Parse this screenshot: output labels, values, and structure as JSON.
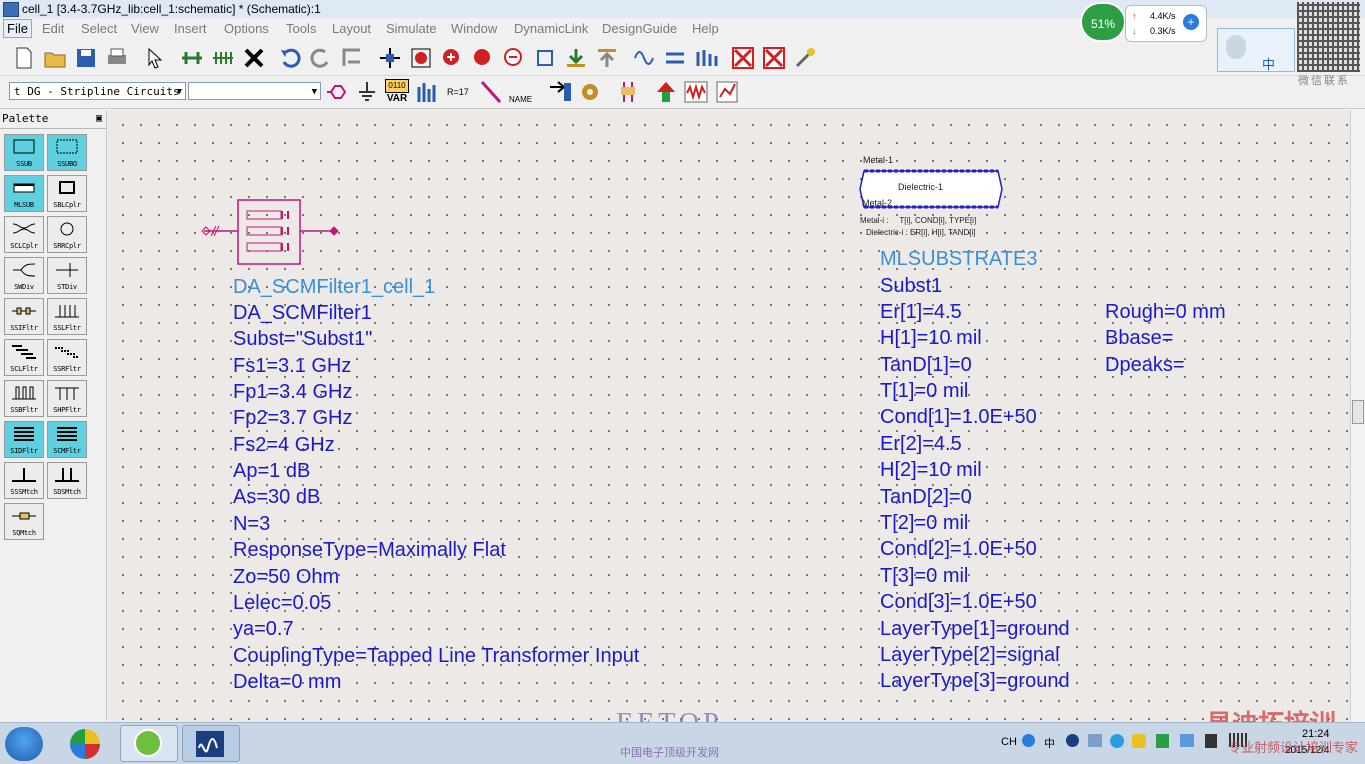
{
  "window": {
    "title": "cell_1 [3.4-3.7GHz_lib:cell_1:schematic] * (Schematic):1"
  },
  "menu": [
    "File",
    "Edit",
    "Select",
    "View",
    "Insert",
    "Options",
    "Tools",
    "Layout",
    "Simulate",
    "Window",
    "DynamicLink",
    "DesignGuide",
    "Help"
  ],
  "toolbar2": {
    "palette_combo": "t DG - Stripline Circuits",
    "component_combo": "",
    "var_label": "VAR",
    "var_top": "0110",
    "r_label": "R=17",
    "name_label": "NAME"
  },
  "palette": {
    "title": "Palette",
    "items": [
      "SSUB",
      "SSUBO",
      "MLSUB",
      "SBLCplr",
      "SCLCplr",
      "SRRCplr",
      "SWDiv",
      "STDiv",
      "SSIFltr",
      "SSLFltr",
      "SCLFltr",
      "SSRFltr",
      "SSBFltr",
      "SHPFltr",
      "SIDFltr",
      "SCMFltr",
      "SSSMtch",
      "SDSMtch",
      "SQMtch"
    ]
  },
  "filter": {
    "instance": "DA_SCMFilter1_cell_1",
    "params": [
      "DA_SCMFilter1",
      "Subst=\"Subst1\"",
      "Fs1=3.1 GHz",
      "Fp1=3.4 GHz",
      "Fp2=3.7 GHz",
      "Fs2=4 GHz",
      "Ap=1 dB",
      "As=30 dB",
      "N=3",
      "ResponseType=Maximally Flat",
      "Zo=50 Ohm",
      "Lelec=0.05",
      "ya=0.7",
      "CouplingType=Tapped Line Transformer Input",
      "Delta=0 mm"
    ]
  },
  "substrate": {
    "symbol": {
      "metal1": "Metal-1",
      "dielectric": "Dielectric-1",
      "metal2": "Metal-2",
      "metal_i": "Metal-i :     T[i], COND[i], TYPE[i]",
      "dielectric_i": "Dielectric-i : ER[i], H[i], TAND[i]"
    },
    "instance": "MLSUBSTRATE3",
    "params": [
      "Subst1",
      "Er[1]=4.5",
      "H[1]=10 mil",
      "TanD[1]=0",
      "T[1]=0 mil",
      "Cond[1]=1.0E+50",
      "Er[2]=4.5",
      "H[2]=10 mil",
      "TanD[2]=0",
      "T[2]=0 mil",
      "T[3]=0 mil",
      "Cond[3]=1.0E+50",
      "LayerType[1]=ground",
      "LayerType[2]=signal",
      "LayerType[3]=ground"
    ],
    "params2": [
      "Rough=0 mm",
      "Bbase=",
      "Dpeaks="
    ],
    "cond2": "Cond[2]=1.0E+50"
  },
  "overlay": {
    "percent": "51%",
    "up": "4.4K/s",
    "down": "0.3K/s",
    "ime": "中"
  },
  "watermark": {
    "eetop": "EETOP",
    "eetop_sub": "中国电子顶级开发网",
    "brand": "易迪拓培训",
    "brand_sub": "专业射频设计培训专家",
    "qr_sub": "微信联系"
  },
  "tray": {
    "lang": "CH",
    "time": "21:24",
    "date": "2015/12/4"
  },
  "colors": {
    "param": "#1a1acc",
    "instance": "#3a8fd8",
    "filter_symbol": "#c0167a",
    "canvas": "#ece9e7"
  }
}
